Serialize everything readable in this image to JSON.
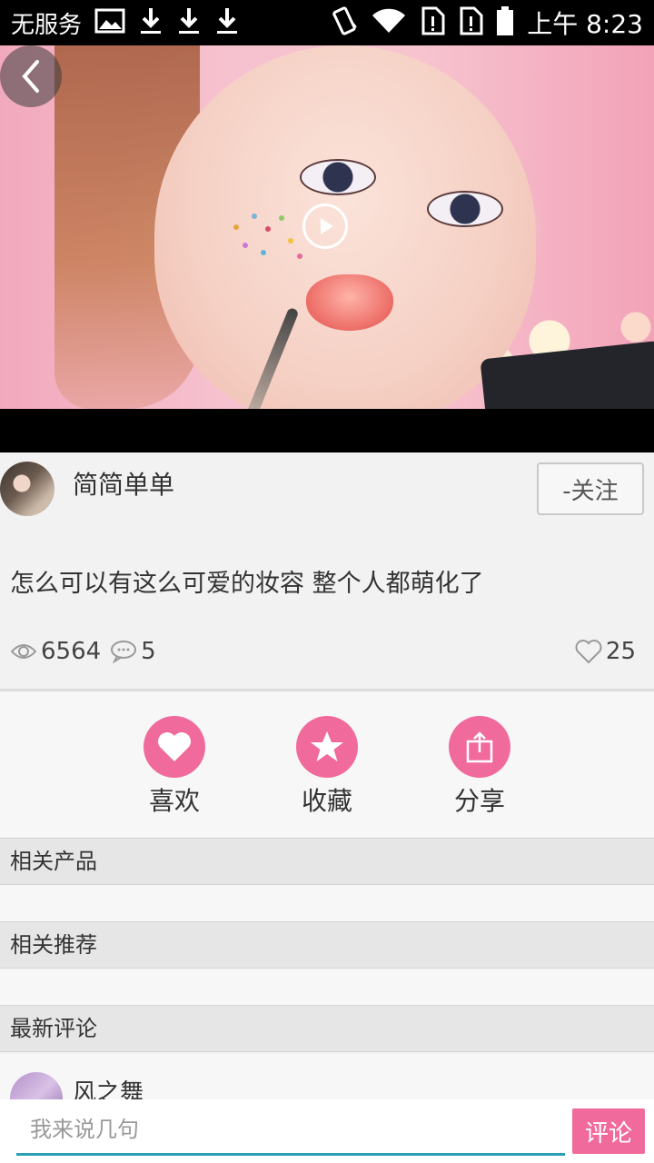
{
  "status_bar": {
    "carrier": "无服务",
    "time": "上午 8:23"
  },
  "video": {
    "back_icon": "chevron-left-icon",
    "play_icon": "play-icon"
  },
  "post": {
    "author": "简简单单",
    "follow_label": "-关注",
    "text": "怎么可以有这么可爱的妆容 整个人都萌化了",
    "views": "6564",
    "comments": "5",
    "likes": "25"
  },
  "actions": [
    {
      "label": "喜欢",
      "icon": "heart-icon"
    },
    {
      "label": "收藏",
      "icon": "star-icon"
    },
    {
      "label": "分享",
      "icon": "share-icon"
    }
  ],
  "sections": {
    "related_products": "相关产品",
    "related_recommend": "相关推荐",
    "latest_comments": "最新评论"
  },
  "comments": [
    {
      "name": "风之舞"
    }
  ],
  "comment_bar": {
    "placeholder": "我来说几句",
    "submit_label": "评论"
  },
  "colors": {
    "accent": "#f06b9b",
    "input_underline": "#2a9fb5"
  }
}
